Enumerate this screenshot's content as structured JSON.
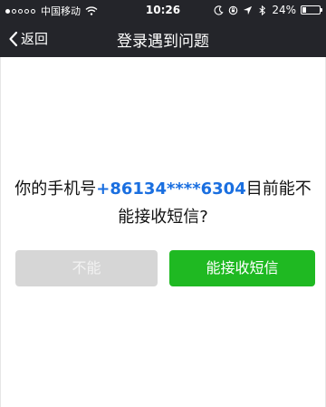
{
  "status_bar": {
    "carrier": "中国移动",
    "time": "10:26",
    "battery": "24%"
  },
  "nav": {
    "back_label": "返回",
    "title": "登录遇到问题"
  },
  "prompt": {
    "before": "你的手机号",
    "phone": "+86134****6304",
    "after": "目前能不能接收短信?"
  },
  "buttons": {
    "no_label": "不能",
    "yes_label": "能接收短信"
  },
  "colors": {
    "nav_bg": "#24252a",
    "phone_text": "#1a6fe0",
    "confirm_button": "#1fb922",
    "disabled_button": "#d6d6d6"
  },
  "icons": [
    "signal-dots-icon",
    "wifi-icon",
    "moon-icon",
    "lock-rotation-icon",
    "location-arrow-icon",
    "bluetooth-icon",
    "battery-icon",
    "back-chevron-icon"
  ]
}
